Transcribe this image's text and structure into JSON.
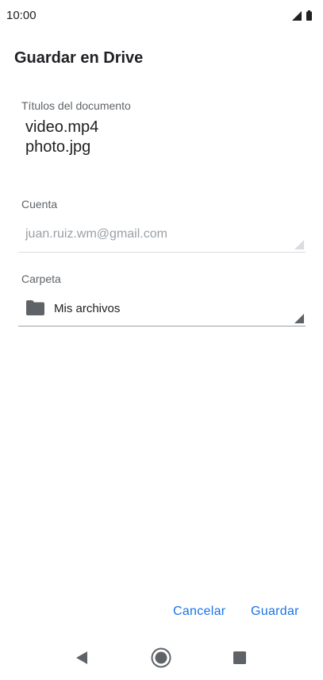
{
  "status_bar": {
    "time": "10:00",
    "icons": [
      "signal-icon",
      "battery-icon"
    ]
  },
  "dialog": {
    "title": "Guardar en Drive",
    "document_titles": {
      "label": "Títulos del documento",
      "items": [
        "video.mp4",
        "photo.jpg"
      ]
    },
    "account": {
      "label": "Cuenta",
      "value": "juan.ruiz.wm@gmail.com"
    },
    "folder": {
      "label": "Carpeta",
      "value": "Mis archivos",
      "icon": "folder-icon"
    },
    "buttons": {
      "cancel": "Cancelar",
      "save": "Guardar"
    }
  },
  "nav_bar": {
    "icons": [
      "back-icon",
      "home-icon",
      "recents-icon"
    ]
  },
  "colors": {
    "accent": "#1a73e8",
    "text_primary": "#202124",
    "text_secondary": "#5f6368",
    "text_disabled": "#9aa0a6"
  }
}
